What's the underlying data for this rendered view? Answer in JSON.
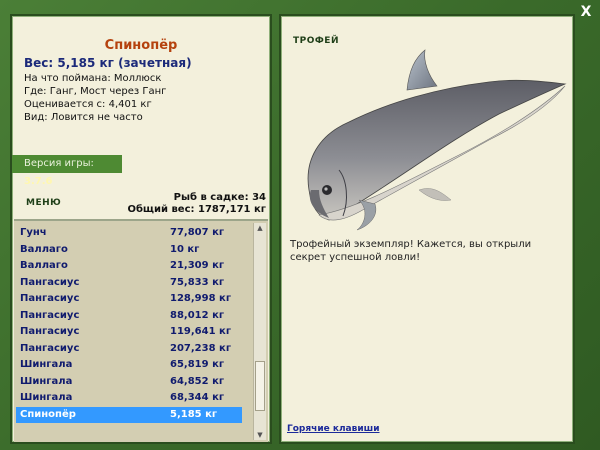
{
  "close_label": "X",
  "fish": {
    "name": "Спинопёр",
    "weight_line": "Вес: 5,185 кг (зачетная)",
    "bait": "На что поймана: Моллюск",
    "location": "Где: Ганг, Мост через Ганг",
    "valued_from": "Оценивается с: 4,401 кг",
    "kind": "Вид: Ловится не часто"
  },
  "version": {
    "label": "Версия игры:",
    "value": "3.7.6"
  },
  "menu_label": "МЕНЮ",
  "stats": {
    "fish_in_keepnet": "Рыб в садке: 34",
    "total_weight": "Общий вес: 1787,171 кг"
  },
  "catch_list": [
    {
      "name": "Гунч",
      "weight": "77,807 кг"
    },
    {
      "name": "Валлаго",
      "weight": "10 кг"
    },
    {
      "name": "Валлаго",
      "weight": "21,309 кг"
    },
    {
      "name": "Пангасиус",
      "weight": "75,833 кг"
    },
    {
      "name": "Пангасиус",
      "weight": "128,998 кг"
    },
    {
      "name": "Пангасиус",
      "weight": "88,012 кг"
    },
    {
      "name": "Пангасиус",
      "weight": "119,641 кг"
    },
    {
      "name": "Пангасиус",
      "weight": "207,238 кг"
    },
    {
      "name": "Шингала",
      "weight": "65,819 кг"
    },
    {
      "name": "Шингала",
      "weight": "64,852 кг"
    },
    {
      "name": "Шингала",
      "weight": "68,344 кг"
    },
    {
      "name": "Спинопёр",
      "weight": "5,185 кг",
      "selected": true
    }
  ],
  "trophy": {
    "label": "ТРОФЕЙ",
    "text": "Трофейный экземпляр! Кажется, вы открыли секрет успешной ловли!"
  },
  "hotkeys_label": "Горячие клавиши",
  "colors": {
    "frame_green": "#3a6a2a",
    "panel_bg": "#f3f0dc",
    "fish_name": "#b5420e",
    "list_text": "#101b6e",
    "selection": "#3399ff"
  }
}
